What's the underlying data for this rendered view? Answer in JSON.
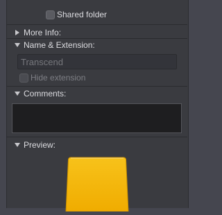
{
  "sharing": {
    "shared_folder_label": "Shared folder"
  },
  "sections": {
    "more_info": {
      "title": "More Info:"
    },
    "name_extension": {
      "title": "Name & Extension:",
      "name_value": "Transcend",
      "hide_extension_label": "Hide extension"
    },
    "comments": {
      "title": "Comments:",
      "value": ""
    },
    "preview": {
      "title": "Preview:",
      "icon": "external-drive-icon",
      "icon_color": "#f5b800"
    }
  }
}
